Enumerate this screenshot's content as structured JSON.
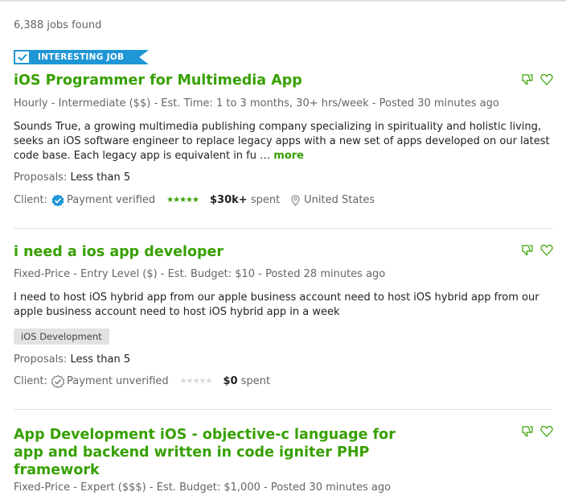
{
  "results": {
    "count_text": "6,388 jobs found"
  },
  "jobs": [
    {
      "badge": "INTERESTING JOB",
      "title": "iOS Programmer for Multimedia App",
      "type": "Hourly",
      "level": "Intermediate ($$)",
      "duration_label": "Est. Time:",
      "duration": "1 to 3 months, 30+ hrs/week",
      "posted": "Posted 30 minutes ago",
      "description": "Sounds True, a growing multimedia publishing company specializing in spirituality and holistic living, seeks an iOS software engineer to replace legacy apps with a new set of apps developed on our latest code base. Each legacy app is equivalent in fu …",
      "more_label": "more",
      "proposals_label": "Proposals:",
      "proposals_value": "Less than 5",
      "client_label": "Client:",
      "payment_status": "Payment verified",
      "rating_stars": 5,
      "spent_amount": "$30k+",
      "spent_suffix": "spent",
      "location": "United States"
    },
    {
      "title": "i need a ios app developer",
      "type": "Fixed-Price",
      "level": "Entry Level ($)",
      "budget_label": "Est. Budget:",
      "budget": "$10",
      "posted": "Posted 28 minutes ago",
      "description": "I need to host iOS hybrid app from our apple business account need to host iOS hybrid app from our apple business account need to host iOS hybrid app in a week",
      "skill": "iOS Development",
      "proposals_label": "Proposals:",
      "proposals_value": "Less than 5",
      "client_label": "Client:",
      "payment_status": "Payment unverified",
      "rating_stars": 0,
      "spent_amount": "$0",
      "spent_suffix": "spent"
    },
    {
      "title": "App Development iOS - objective-c language for app and backend written in code igniter PHP framework",
      "type": "Fixed-Price",
      "level": "Expert ($$$)",
      "budget_label": "Est. Budget:",
      "budget": "$1,000",
      "posted": "Posted 30 minutes ago"
    }
  ],
  "icons": {
    "dislike": "thumbs-down-icon",
    "save": "heart-icon",
    "verified": "verified-check-icon",
    "unverified": "unverified-check-icon",
    "location": "map-pin-icon"
  },
  "colors": {
    "accent_green": "#37a000",
    "badge_blue": "#1f96d6",
    "verified_blue": "#1f96d6",
    "meta_gray": "#656565"
  }
}
